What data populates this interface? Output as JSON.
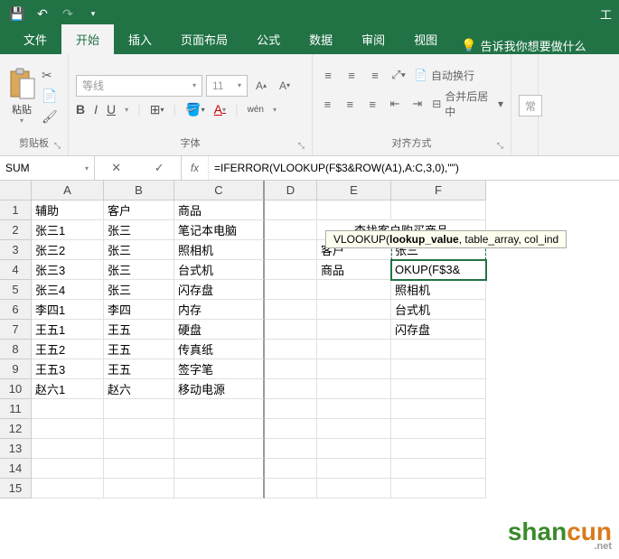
{
  "titlebar": {
    "title": "工"
  },
  "tabs": {
    "file": "文件",
    "home": "开始",
    "insert": "插入",
    "layout": "页面布局",
    "formula": "公式",
    "data": "数据",
    "review": "审阅",
    "view": "视图",
    "tell": "告诉我你想要做什么"
  },
  "ribbon": {
    "clipboard": {
      "paste": "粘贴",
      "label": "剪贴板"
    },
    "font": {
      "name": "等线",
      "size": "11",
      "label": "字体",
      "bold": "B",
      "italic": "I",
      "underline": "U",
      "wen": "wén"
    },
    "align": {
      "wrap": "自动换行",
      "merge": "合并后居中",
      "label": "对齐方式"
    },
    "general": "常"
  },
  "formula_bar": {
    "name_box": "SUM",
    "formula": "=IFERROR(VLOOKUP(F$3&ROW(A1),A:C,3,0),\"\")"
  },
  "tooltip": {
    "fn": "VLOOKUP(",
    "bold": "lookup_value",
    "rest": ", table_array, col_ind"
  },
  "columns": [
    "A",
    "B",
    "C",
    "D",
    "E",
    "F"
  ],
  "col_widths": {
    "A": 80,
    "B": 78,
    "C": 100,
    "D": 58,
    "E": 82,
    "F": 105
  },
  "grid": {
    "rows": [
      {
        "n": 1,
        "A": "辅助",
        "B": "客户",
        "C": "商品",
        "E": "",
        "F": ""
      },
      {
        "n": 2,
        "A": "张三1",
        "B": "张三",
        "C": "笔记本电脑",
        "E": "查找客户购买商品",
        "F": ""
      },
      {
        "n": 3,
        "A": "张三2",
        "B": "张三",
        "C": "照相机",
        "E": "客户",
        "F": "张三"
      },
      {
        "n": 4,
        "A": "张三3",
        "B": "张三",
        "C": "台式机",
        "E": "商品",
        "F": "OKUP(F$3&"
      },
      {
        "n": 5,
        "A": "张三4",
        "B": "张三",
        "C": "闪存盘",
        "E": "",
        "F": "照相机"
      },
      {
        "n": 6,
        "A": "李四1",
        "B": "李四",
        "C": "内存",
        "E": "",
        "F": "台式机"
      },
      {
        "n": 7,
        "A": "王五1",
        "B": "王五",
        "C": "硬盘",
        "E": "",
        "F": "闪存盘"
      },
      {
        "n": 8,
        "A": "王五2",
        "B": "王五",
        "C": "传真纸",
        "E": "",
        "F": ""
      },
      {
        "n": 9,
        "A": "王五3",
        "B": "王五",
        "C": "签字笔",
        "E": "",
        "F": ""
      },
      {
        "n": 10,
        "A": "赵六1",
        "B": "赵六",
        "C": "移动电源",
        "E": "",
        "F": ""
      },
      {
        "n": 11
      },
      {
        "n": 12
      },
      {
        "n": 13
      },
      {
        "n": 14
      },
      {
        "n": 15
      }
    ]
  },
  "watermark": {
    "text1": "shan",
    "text2": "cun",
    "sub": ".net"
  }
}
